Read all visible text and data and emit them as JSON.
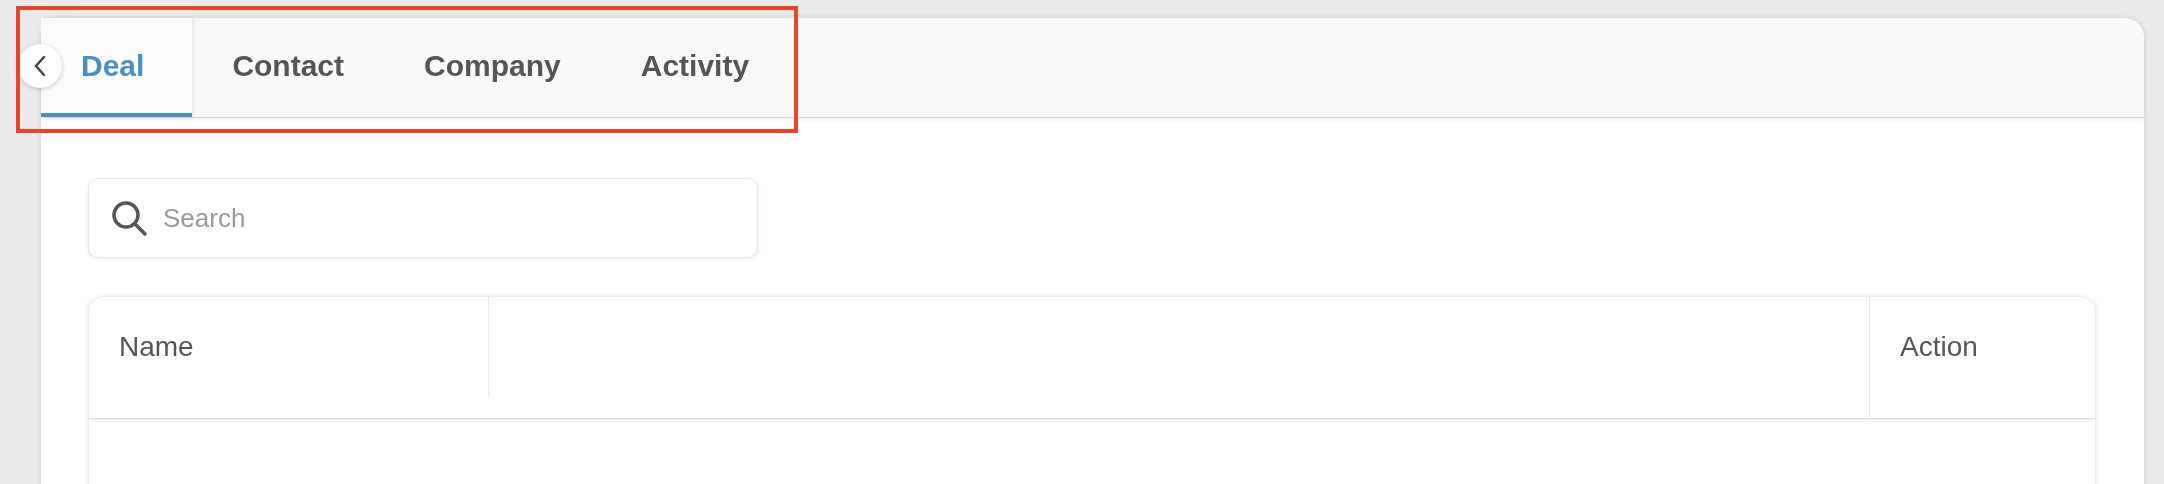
{
  "tabs": [
    {
      "label": "Deal",
      "selected": true
    },
    {
      "label": "Contact",
      "selected": false
    },
    {
      "label": "Company",
      "selected": false
    },
    {
      "label": "Activity",
      "selected": false
    }
  ],
  "search": {
    "placeholder": "Search"
  },
  "table": {
    "columns": [
      "Name",
      "",
      "Action"
    ]
  }
}
